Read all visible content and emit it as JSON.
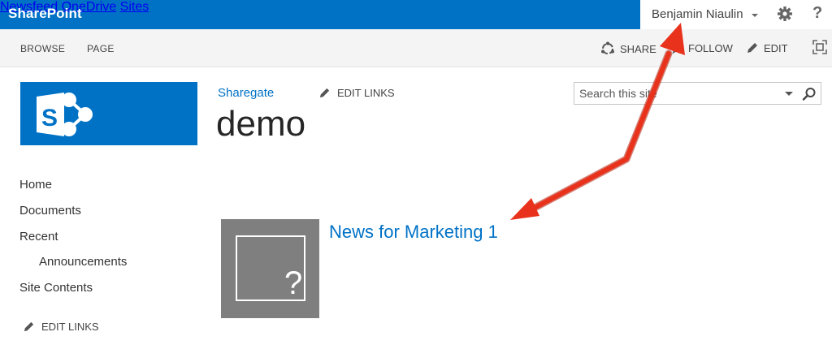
{
  "suitebar": {
    "brand": "SharePoint",
    "nav": [
      "Newsfeed",
      "OneDrive",
      "Sites"
    ],
    "user": "Benjamin Niaulin",
    "help_glyph": "?"
  },
  "ribbon": {
    "tabs": [
      "BROWSE",
      "PAGE"
    ],
    "actions": [
      "SHARE",
      "FOLLOW",
      "EDIT"
    ]
  },
  "header": {
    "breadcrumb": "Sharegate",
    "edit_links": "EDIT LINKS",
    "title": "demo"
  },
  "search": {
    "placeholder": "Search this site"
  },
  "quicklaunch": {
    "items": [
      "Home",
      "Documents",
      "Recent",
      "Announcements",
      "Site Contents"
    ],
    "edit_links": "EDIT LINKS"
  },
  "content": {
    "news_title": "News for Marketing 1",
    "thumbnail_glyph": "?"
  },
  "colors": {
    "suite_blue": "#0072c6",
    "annotation_red": "#e8321c"
  },
  "icons": [
    "gear-icon",
    "help-icon",
    "share-icon",
    "follow-star-icon",
    "edit-pencil-icon",
    "focus-mode-icon",
    "sharepoint-logo-icon",
    "search-icon",
    "dropdown-icon"
  ]
}
